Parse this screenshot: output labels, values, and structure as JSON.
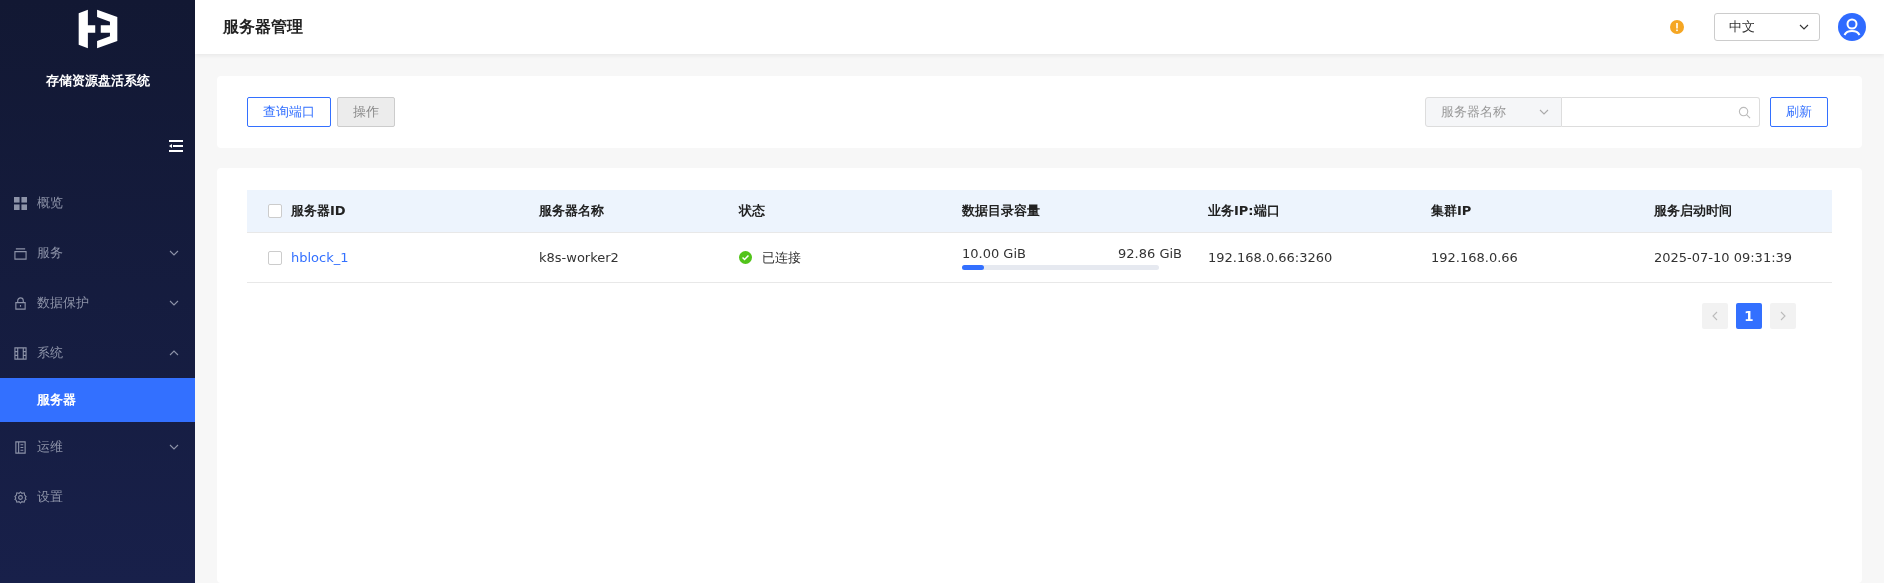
{
  "sidebar": {
    "title": "存储资源盘活系统",
    "items": [
      {
        "label": "概览"
      },
      {
        "label": "服务",
        "expanded": false
      },
      {
        "label": "数据保护",
        "expanded": false
      },
      {
        "label": "系统",
        "expanded": true,
        "children": [
          {
            "label": "服务器",
            "selected": true
          }
        ]
      },
      {
        "label": "运维",
        "expanded": false
      },
      {
        "label": "设置"
      }
    ]
  },
  "header": {
    "title": "服务器管理",
    "language": "中文"
  },
  "toolbar": {
    "buttons": [
      {
        "label": "查询端口",
        "disabled": false
      },
      {
        "label": "操作",
        "disabled": true
      }
    ],
    "filter": "服务器名称",
    "refresh": "刷新"
  },
  "table": {
    "select_all": false,
    "columns": [
      "服务器ID",
      "服务器名称",
      "状态",
      "数据目录容量",
      "业务IP:端口",
      "集群IP",
      "服务启动时间"
    ],
    "rows": [
      {
        "checked": false,
        "id": "hblock_1",
        "name": "k8s-worker2",
        "status": "已连接",
        "connected": true,
        "used": "10.00 GiB",
        "total": "92.86 GiB",
        "level": 0.11,
        "ip_port": "192.168.0.66:3260",
        "cluster_ip": "192.168.0.66",
        "start_time": "2025-07-10 09:31:39"
      }
    ]
  },
  "pagination": {
    "pages": [
      {
        "label": "1",
        "selected": true
      }
    ]
  }
}
